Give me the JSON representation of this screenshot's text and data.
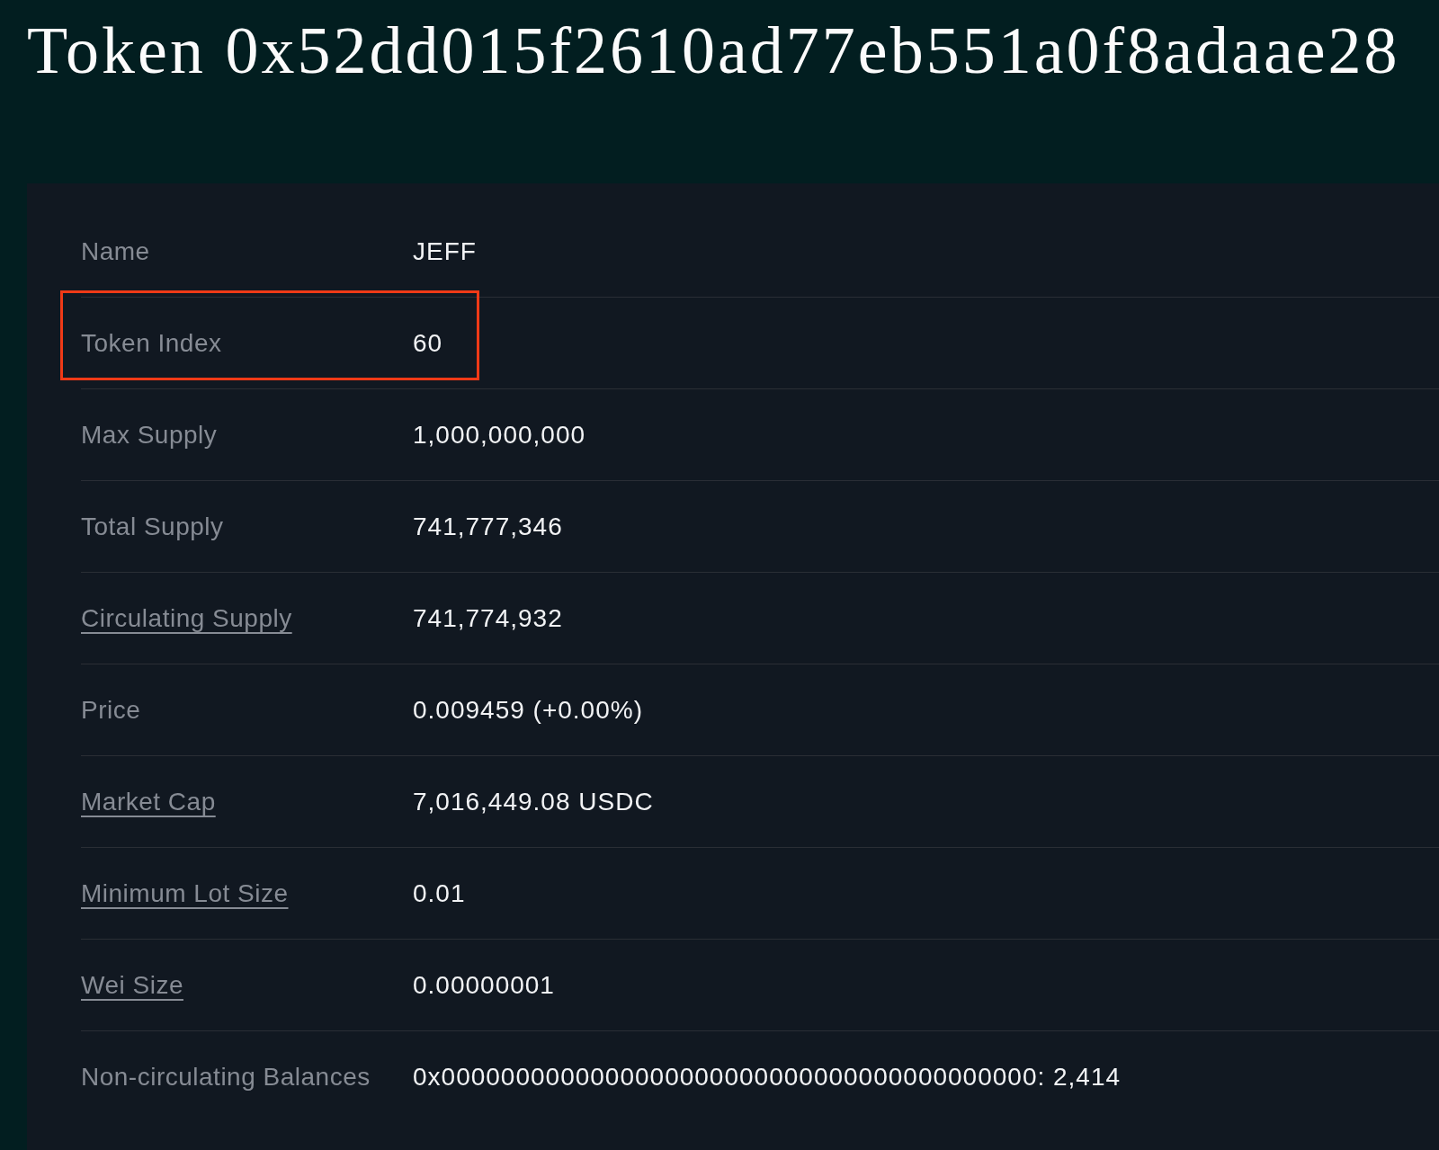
{
  "title": "Token 0x52dd015f2610ad77eb551a0f8adaae28",
  "rows": [
    {
      "label": "Name",
      "value": "JEFF",
      "kind": "plain",
      "highlighted": false
    },
    {
      "label": "Token Index",
      "value": "60",
      "kind": "plain",
      "highlighted": true
    },
    {
      "label": "Max Supply",
      "value": "1,000,000,000",
      "kind": "plain",
      "highlighted": false
    },
    {
      "label": "Total Supply",
      "value": "741,777,346",
      "kind": "plain",
      "highlighted": false
    },
    {
      "label": "Circulating Supply",
      "value": "741,774,932",
      "kind": "link",
      "highlighted": false
    },
    {
      "label": "Price",
      "value": "0.009459 (+0.00%)",
      "kind": "plain",
      "highlighted": false
    },
    {
      "label": "Market Cap",
      "value": "7,016,449.08 USDC",
      "kind": "link",
      "highlighted": false
    },
    {
      "label": "Minimum Lot Size",
      "value": "0.01",
      "kind": "link",
      "highlighted": false
    },
    {
      "label": "Wei Size",
      "value": "0.00000001",
      "kind": "link",
      "highlighted": false
    },
    {
      "label": "Non-circulating Balances",
      "value": "0x0000000000000000000000000000000000000000: 2,414",
      "kind": "plain",
      "highlighted": false
    }
  ]
}
